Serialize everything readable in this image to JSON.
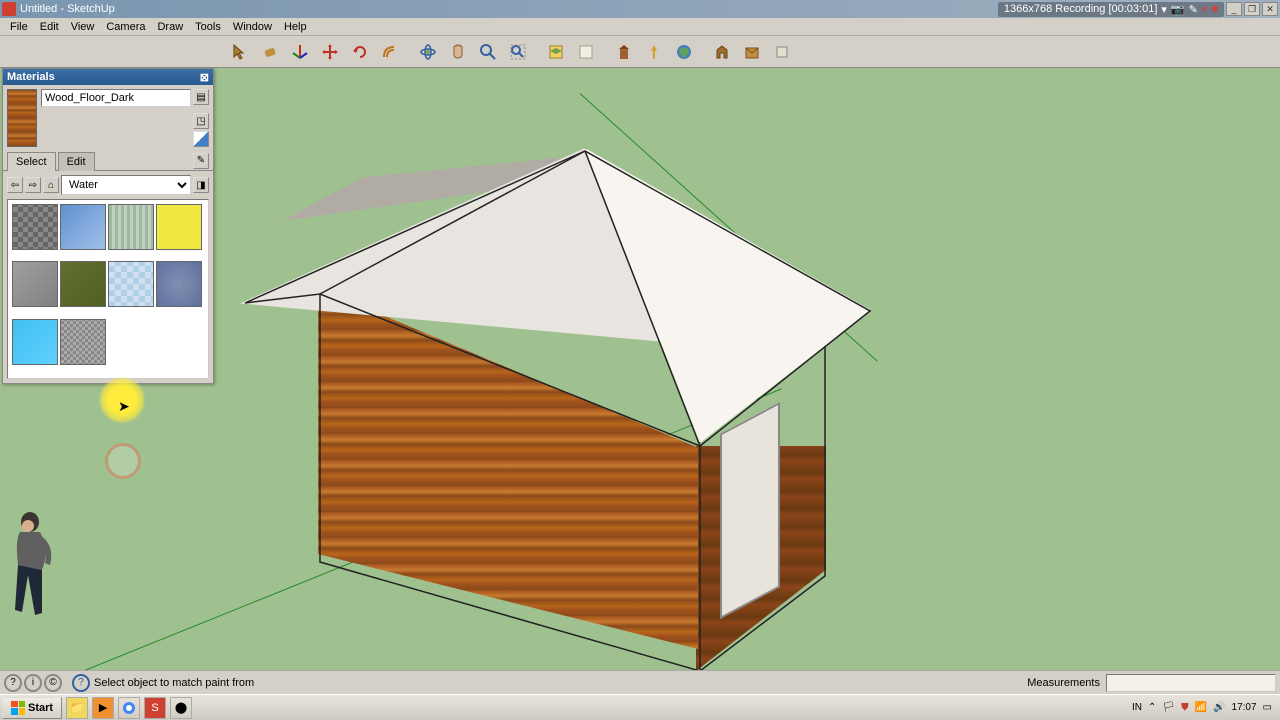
{
  "window": {
    "title": "Untitled - SketchUp",
    "recording": "1366x768  Recording [00:03:01]"
  },
  "menu": [
    "File",
    "Edit",
    "View",
    "Camera",
    "Draw",
    "Tools",
    "Window",
    "Help"
  ],
  "materials": {
    "panel_title": "Materials",
    "material_name": "Wood_Floor_Dark",
    "tabs": {
      "select": "Select",
      "edit": "Edit"
    },
    "library": "Water"
  },
  "status": {
    "hint": "Select object to match paint from",
    "measurements_label": "Measurements"
  },
  "taskbar": {
    "start": "Start",
    "lang": "IN",
    "clock": "17:07"
  }
}
